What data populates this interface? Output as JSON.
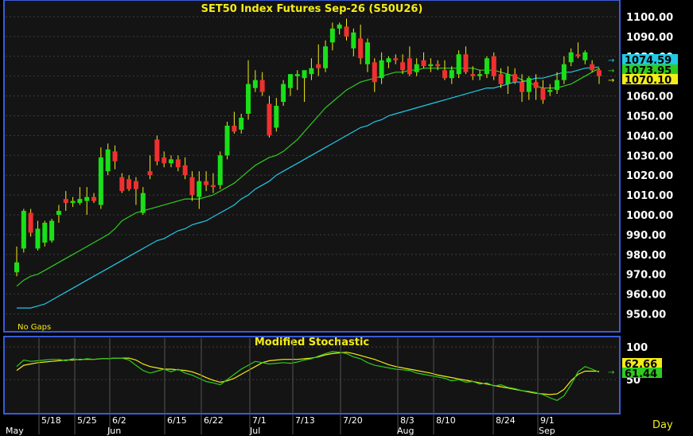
{
  "chart_data": [
    {
      "type": "candlestick",
      "title": "SET50  Index  Futures  Sep-26  (S50U26)",
      "note": "No  Gaps",
      "ylim": [
        943,
        1106
      ],
      "yticks": [
        950,
        960,
        970,
        980,
        990,
        1000,
        1010,
        1020,
        1030,
        1040,
        1050,
        1060,
        1070,
        1080,
        1090,
        1100
      ],
      "price_tags": [
        {
          "value": 1074.59,
          "label": "1074.59",
          "color": "#21c9e6"
        },
        {
          "value": 1073.95,
          "label": "1073.95",
          "color": "#2ecc1f"
        },
        {
          "value": 1070.1,
          "label": "1070.10",
          "color": "#f4ec19"
        }
      ],
      "candles": [
        {
          "o": 971,
          "h": 984,
          "l": 969,
          "c": 976
        },
        {
          "o": 983,
          "h": 1003,
          "l": 981,
          "c": 1002
        },
        {
          "o": 1001,
          "h": 1003,
          "l": 989,
          "c": 991
        },
        {
          "o": 983,
          "h": 997,
          "l": 982,
          "c": 993
        },
        {
          "o": 986,
          "h": 997,
          "l": 984,
          "c": 996
        },
        {
          "o": 987,
          "h": 998,
          "l": 986,
          "c": 997
        },
        {
          "o": 1000,
          "h": 1005,
          "l": 996,
          "c": 1002
        },
        {
          "o": 1008,
          "h": 1012,
          "l": 1002,
          "c": 1006
        },
        {
          "o": 1006,
          "h": 1009,
          "l": 1004,
          "c": 1007
        },
        {
          "o": 1006,
          "h": 1014,
          "l": 1005,
          "c": 1008
        },
        {
          "o": 1007,
          "h": 1014,
          "l": 1000,
          "c": 1009
        },
        {
          "o": 1009,
          "h": 1011,
          "l": 1006,
          "c": 1007
        },
        {
          "o": 1005,
          "h": 1034,
          "l": 1003,
          "c": 1029
        },
        {
          "o": 1022,
          "h": 1036,
          "l": 1020,
          "c": 1033
        },
        {
          "o": 1032,
          "h": 1035,
          "l": 1023,
          "c": 1027
        },
        {
          "o": 1019,
          "h": 1021,
          "l": 1011,
          "c": 1012
        },
        {
          "o": 1018,
          "h": 1020,
          "l": 1012,
          "c": 1013
        },
        {
          "o": 1017,
          "h": 1019,
          "l": 1005,
          "c": 1013
        },
        {
          "o": 1001,
          "h": 1014,
          "l": 1000,
          "c": 1011
        },
        {
          "o": 1022,
          "h": 1030,
          "l": 1018,
          "c": 1020
        },
        {
          "o": 1038,
          "h": 1040,
          "l": 1025,
          "c": 1027
        },
        {
          "o": 1029,
          "h": 1032,
          "l": 1024,
          "c": 1026
        },
        {
          "o": 1026,
          "h": 1030,
          "l": 1024,
          "c": 1028
        },
        {
          "o": 1028,
          "h": 1030,
          "l": 1022,
          "c": 1024
        },
        {
          "o": 1025,
          "h": 1029,
          "l": 1018,
          "c": 1020
        },
        {
          "o": 1019,
          "h": 1022,
          "l": 1007,
          "c": 1010
        },
        {
          "o": 1009,
          "h": 1022,
          "l": 1003,
          "c": 1017
        },
        {
          "o": 1017,
          "h": 1022,
          "l": 1012,
          "c": 1015
        },
        {
          "o": 1015,
          "h": 1021,
          "l": 1011,
          "c": 1014
        },
        {
          "o": 1015,
          "h": 1032,
          "l": 1013,
          "c": 1030
        },
        {
          "o": 1030,
          "h": 1047,
          "l": 1028,
          "c": 1045
        },
        {
          "o": 1045,
          "h": 1052,
          "l": 1041,
          "c": 1042
        },
        {
          "o": 1043,
          "h": 1051,
          "l": 1041,
          "c": 1049
        },
        {
          "o": 1051,
          "h": 1078,
          "l": 1048,
          "c": 1066
        },
        {
          "o": 1064,
          "h": 1073,
          "l": 1062,
          "c": 1068
        },
        {
          "o": 1068,
          "h": 1072,
          "l": 1060,
          "c": 1062
        },
        {
          "o": 1056,
          "h": 1060,
          "l": 1039,
          "c": 1040
        },
        {
          "o": 1044,
          "h": 1059,
          "l": 1042,
          "c": 1055
        },
        {
          "o": 1057,
          "h": 1068,
          "l": 1055,
          "c": 1066
        },
        {
          "o": 1064,
          "h": 1071,
          "l": 1060,
          "c": 1071
        },
        {
          "o": 1070,
          "h": 1073,
          "l": 1063,
          "c": 1071
        },
        {
          "o": 1069,
          "h": 1072,
          "l": 1057,
          "c": 1073
        },
        {
          "o": 1071,
          "h": 1079,
          "l": 1068,
          "c": 1074
        },
        {
          "o": 1076,
          "h": 1086,
          "l": 1070,
          "c": 1074
        },
        {
          "o": 1074,
          "h": 1088,
          "l": 1072,
          "c": 1085
        },
        {
          "o": 1087,
          "h": 1097,
          "l": 1083,
          "c": 1094
        },
        {
          "o": 1094,
          "h": 1097,
          "l": 1091,
          "c": 1096
        },
        {
          "o": 1095,
          "h": 1099,
          "l": 1088,
          "c": 1090
        },
        {
          "o": 1084,
          "h": 1094,
          "l": 1080,
          "c": 1092
        },
        {
          "o": 1089,
          "h": 1096,
          "l": 1076,
          "c": 1079
        },
        {
          "o": 1076,
          "h": 1089,
          "l": 1072,
          "c": 1087
        },
        {
          "o": 1077,
          "h": 1079,
          "l": 1062,
          "c": 1067
        },
        {
          "o": 1069,
          "h": 1082,
          "l": 1066,
          "c": 1078
        },
        {
          "o": 1077,
          "h": 1080,
          "l": 1074,
          "c": 1079
        },
        {
          "o": 1079,
          "h": 1081,
          "l": 1076,
          "c": 1078
        },
        {
          "o": 1077,
          "h": 1081,
          "l": 1071,
          "c": 1073
        },
        {
          "o": 1079,
          "h": 1085,
          "l": 1070,
          "c": 1071
        },
        {
          "o": 1072,
          "h": 1079,
          "l": 1070,
          "c": 1076
        },
        {
          "o": 1078,
          "h": 1082,
          "l": 1074,
          "c": 1075
        },
        {
          "o": 1075,
          "h": 1079,
          "l": 1072,
          "c": 1076
        },
        {
          "o": 1076,
          "h": 1078,
          "l": 1073,
          "c": 1075
        },
        {
          "o": 1073,
          "h": 1078,
          "l": 1068,
          "c": 1069
        },
        {
          "o": 1069,
          "h": 1075,
          "l": 1066,
          "c": 1073
        },
        {
          "o": 1071,
          "h": 1083,
          "l": 1069,
          "c": 1081
        },
        {
          "o": 1081,
          "h": 1085,
          "l": 1071,
          "c": 1072
        },
        {
          "o": 1071,
          "h": 1075,
          "l": 1068,
          "c": 1070
        },
        {
          "o": 1070,
          "h": 1073,
          "l": 1068,
          "c": 1071
        },
        {
          "o": 1071,
          "h": 1080,
          "l": 1069,
          "c": 1079
        },
        {
          "o": 1080,
          "h": 1082,
          "l": 1068,
          "c": 1070
        },
        {
          "o": 1071,
          "h": 1074,
          "l": 1064,
          "c": 1066
        },
        {
          "o": 1066,
          "h": 1075,
          "l": 1061,
          "c": 1071
        },
        {
          "o": 1071,
          "h": 1074,
          "l": 1066,
          "c": 1067
        },
        {
          "o": 1067,
          "h": 1071,
          "l": 1057,
          "c": 1062
        },
        {
          "o": 1062,
          "h": 1070,
          "l": 1058,
          "c": 1069
        },
        {
          "o": 1067,
          "h": 1071,
          "l": 1058,
          "c": 1064
        },
        {
          "o": 1064,
          "h": 1068,
          "l": 1056,
          "c": 1058
        },
        {
          "o": 1062,
          "h": 1066,
          "l": 1060,
          "c": 1063
        },
        {
          "o": 1063,
          "h": 1072,
          "l": 1061,
          "c": 1068
        },
        {
          "o": 1068,
          "h": 1080,
          "l": 1066,
          "c": 1076
        },
        {
          "o": 1077,
          "h": 1084,
          "l": 1075,
          "c": 1082
        },
        {
          "o": 1081,
          "h": 1087,
          "l": 1079,
          "c": 1080
        },
        {
          "o": 1078,
          "h": 1083,
          "l": 1076,
          "c": 1082
        },
        {
          "o": 1076,
          "h": 1078,
          "l": 1072,
          "c": 1073
        },
        {
          "o": 1073,
          "h": 1074,
          "l": 1066,
          "c": 1070
        }
      ],
      "ma_green": [
        964,
        967,
        969,
        970,
        972,
        974,
        976,
        978,
        980,
        982,
        984,
        986,
        988,
        990,
        993,
        997,
        999,
        1001,
        1002,
        1003,
        1004,
        1005,
        1006,
        1007,
        1008,
        1008,
        1008,
        1009,
        1010,
        1012,
        1014,
        1016,
        1019,
        1022,
        1025,
        1027,
        1029,
        1030,
        1032,
        1035,
        1038,
        1042,
        1046,
        1050,
        1054,
        1057,
        1060,
        1063,
        1065,
        1067,
        1068,
        1069,
        1070,
        1071,
        1072,
        1072,
        1073,
        1073,
        1074,
        1074,
        1074,
        1074,
        1074,
        1074,
        1074,
        1074,
        1073,
        1073,
        1073,
        1072,
        1071,
        1070,
        1068,
        1067,
        1065,
        1064,
        1064,
        1064,
        1065,
        1066,
        1068,
        1070,
        1072,
        1073.95
      ],
      "ma_cyan": [
        953,
        953,
        953,
        954,
        955,
        957,
        959,
        961,
        963,
        965,
        967,
        969,
        971,
        973,
        975,
        977,
        979,
        981,
        983,
        985,
        987,
        988,
        990,
        992,
        993,
        995,
        996,
        997,
        999,
        1001,
        1003,
        1005,
        1008,
        1010,
        1013,
        1015,
        1017,
        1020,
        1022,
        1024,
        1026,
        1028,
        1030,
        1032,
        1034,
        1036,
        1038,
        1040,
        1042,
        1044,
        1045,
        1047,
        1048,
        1050,
        1051,
        1052,
        1053,
        1054,
        1055,
        1056,
        1057,
        1058,
        1059,
        1060,
        1061,
        1062,
        1063,
        1064,
        1064,
        1065,
        1066,
        1067,
        1067,
        1068,
        1069,
        1069,
        1070,
        1071,
        1072,
        1072,
        1073,
        1074,
        1074.3,
        1074.59
      ]
    },
    {
      "type": "line",
      "title": "Modified  Stochastic",
      "ylim": [
        0,
        110
      ],
      "yticks": [
        50,
        100
      ],
      "price_tags": [
        {
          "value": 62.66,
          "label": "62.66",
          "color": "#f4ec19"
        },
        {
          "value": 61.44,
          "label": "61.44",
          "color": "#2ecc1f"
        }
      ],
      "series": [
        {
          "color": "#f4ec19",
          "values": [
            64,
            72,
            74,
            76,
            77,
            78,
            79,
            80,
            80,
            81,
            81,
            81,
            82,
            82,
            83,
            83,
            83,
            80,
            74,
            70,
            68,
            66,
            66,
            65,
            64,
            62,
            58,
            53,
            49,
            46,
            48,
            52,
            58,
            64,
            70,
            76,
            79,
            80,
            81,
            81,
            81,
            82,
            83,
            85,
            88,
            90,
            91,
            92,
            90,
            87,
            84,
            81,
            77,
            73,
            70,
            68,
            66,
            64,
            62,
            60,
            57,
            55,
            53,
            51,
            49,
            47,
            45,
            43,
            41,
            39,
            37,
            35,
            33,
            31,
            29,
            28,
            27,
            28,
            35,
            48,
            58,
            63,
            63,
            62.66
          ]
        },
        {
          "color": "#2ecc1f",
          "values": [
            70,
            80,
            78,
            79,
            80,
            81,
            81,
            79,
            82,
            80,
            82,
            81,
            82,
            82,
            83,
            83,
            80,
            72,
            64,
            60,
            63,
            66,
            62,
            66,
            60,
            57,
            52,
            47,
            45,
            42,
            50,
            58,
            66,
            72,
            78,
            76,
            74,
            75,
            76,
            75,
            77,
            80,
            82,
            86,
            90,
            93,
            92,
            90,
            85,
            82,
            76,
            72,
            70,
            68,
            66,
            65,
            64,
            60,
            58,
            56,
            54,
            52,
            48,
            50,
            46,
            47,
            43,
            45,
            40,
            42,
            38,
            36,
            33,
            32,
            30,
            27,
            22,
            18,
            25,
            42,
            62,
            70,
            66,
            61.44
          ]
        }
      ]
    }
  ],
  "x_axis": {
    "day_labels": [
      "5/18",
      "5/25",
      "6/2",
      "6/15",
      "6/22",
      "7/1",
      "7/13",
      "7/20",
      "8/3",
      "8/10",
      "8/24",
      "9/1"
    ],
    "month_labels": [
      "May",
      "Jun",
      "Jul",
      "Aug",
      "Sep"
    ],
    "period_label": "Day"
  }
}
